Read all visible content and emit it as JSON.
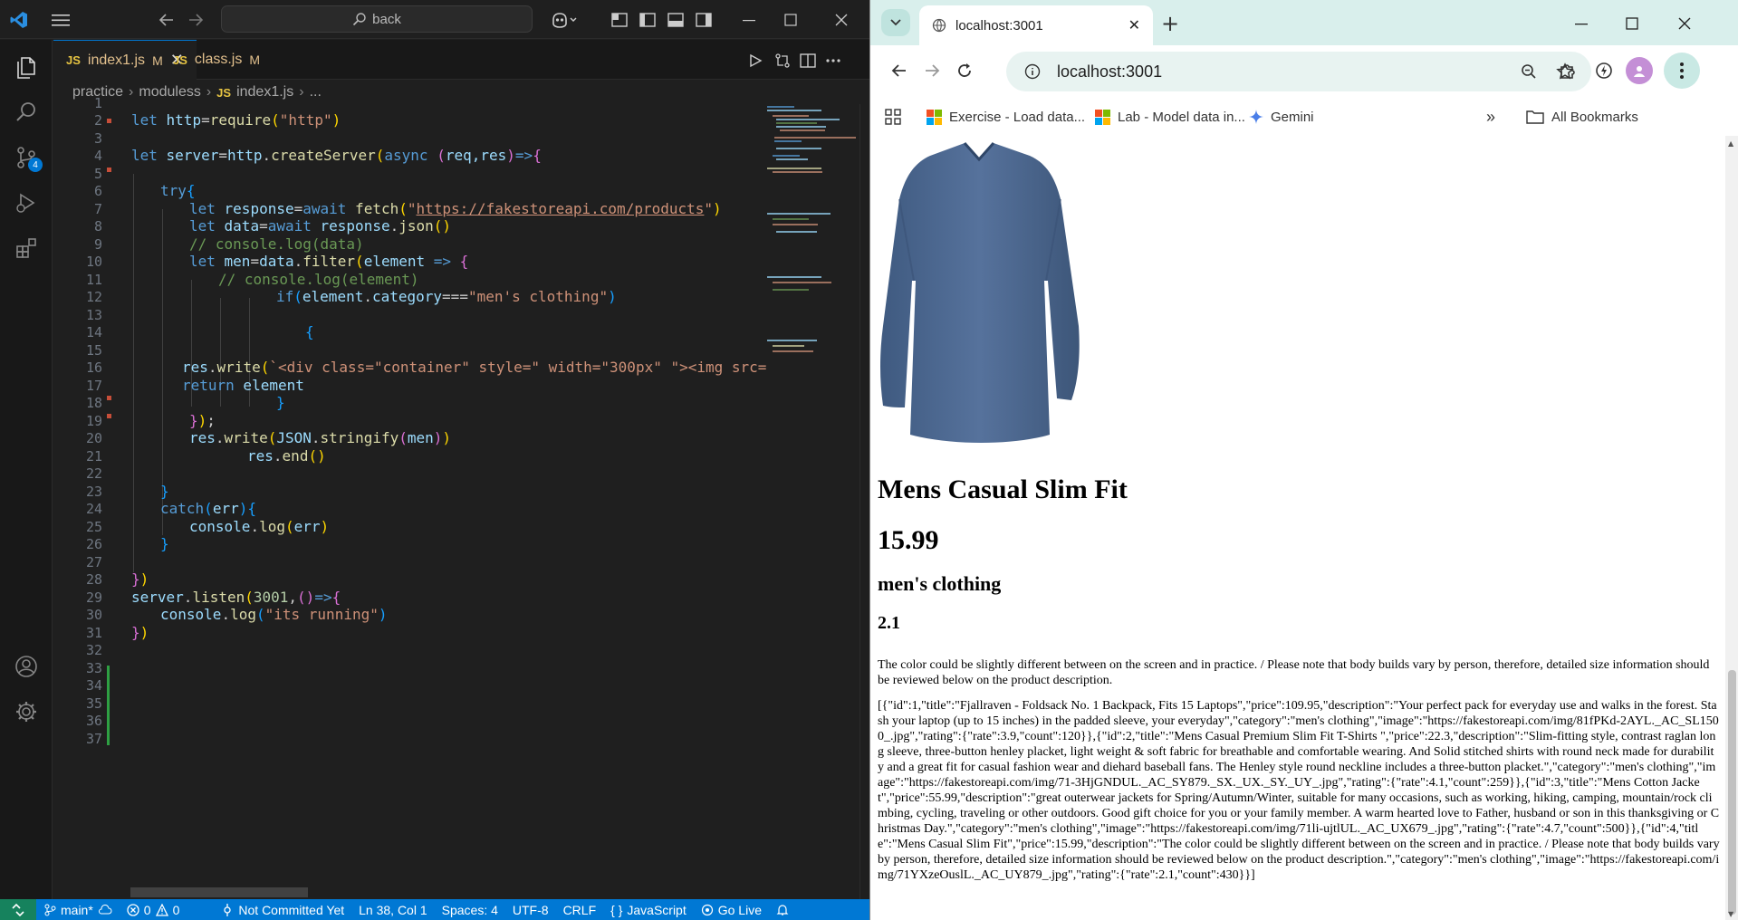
{
  "vscode": {
    "search_text": "back",
    "tabs": [
      {
        "label": "index1.js",
        "modified": "M",
        "icon": "JS"
      },
      {
        "label": "class.js",
        "modified": "M",
        "icon": "JS"
      }
    ],
    "breadcrumb": [
      "practice",
      "moduless",
      "index1.js",
      "..."
    ],
    "scm_badge": "4",
    "statusbar": {
      "branch": "main*",
      "errors": "0",
      "warnings": "0",
      "commit": "Not Committed Yet",
      "position": "Ln 38, Col 1",
      "spaces": "Spaces: 4",
      "encoding": "UTF-8",
      "eol": "CRLF",
      "language": "JavaScript",
      "golive": "Go Live"
    },
    "line_numbers": [
      "1",
      "2",
      "3",
      "4",
      "5",
      "6",
      "7",
      "8",
      "9",
      "10",
      "11",
      "12",
      "13",
      "14",
      "15",
      "16",
      "17",
      "18",
      "19",
      "20",
      "21",
      "22",
      "23",
      "24",
      "25",
      "26",
      "27",
      "28",
      "29",
      "30",
      "31",
      "32",
      "33",
      "34",
      "35",
      "36",
      "37"
    ],
    "code": {
      "l2_let": "let",
      "l2_http": " http",
      "l2_eq": "=",
      "l2_req": "require",
      "l2_str": "\"http\"",
      "l4_let": "let",
      "l4_server": " server",
      "l4_eq": "=",
      "l4_http": "http",
      "l4_create": "createServer",
      "l4_async": "async",
      "l4_args": "req,res",
      "l4_arrow": "=>",
      "l6_try": "try",
      "l7_let": "let",
      "l7_resp": " response",
      "l7_await": "await",
      "l7_fetch": " fetch",
      "l7_url": "https://fakestoreapi.com/products",
      "l8_let": "let",
      "l8_data": " data",
      "l8_await": "await",
      "l8_resp": " response",
      "l8_json": "json",
      "l9_comment": "// console.log(data)",
      "l10_let": "let",
      "l10_men": " men",
      "l10_data": "data",
      "l10_filter": "filter",
      "l10_el": "element",
      "l10_arrow": " => ",
      "l11_comment": "// console.log(element)",
      "l12_if": "if",
      "l12_el": "element",
      "l12_cat": "category",
      "l12_op": "===",
      "l12_str": "\"men's clothing\"",
      "l16_res": "res",
      "l16_write": "write",
      "l16_tpl": "`<div class=\"container\" style=\" width=\"300px\" \"><img src=",
      "l17_return": "return",
      "l17_el": " element",
      "l20_res": "res",
      "l20_write": "write",
      "l20_json": "JSON",
      "l20_str": "stringify",
      "l20_men": "men",
      "l21_res": "res",
      "l21_end": "end",
      "l24_catch": "catch",
      "l24_err": "err",
      "l25_console": "console",
      "l25_log": "log",
      "l25_err": "err",
      "l29_server": "server",
      "l29_listen": "listen",
      "l29_port": "3001",
      "l29_arrow": "=>",
      "l30_console": "console",
      "l30_log": "log",
      "l30_str": "\"its running\""
    }
  },
  "chrome": {
    "tab_title": "localhost:3001",
    "url": "localhost:3001",
    "bookmarks": [
      {
        "label": "Exercise - Load data..."
      },
      {
        "label": "Lab - Model data in..."
      },
      {
        "label": "Gemini"
      },
      {
        "label": "All Bookmarks"
      }
    ],
    "page": {
      "title": "Mens Casual Slim Fit",
      "price": "15.99",
      "category": "men's clothing",
      "rating": "2.1",
      "description": "The color could be slightly different between on the screen and in practice. / Please note that body builds vary by person, therefore, detailed size information should be reviewed below on the product description.",
      "json_output": "[{\"id\":1,\"title\":\"Fjallraven - Foldsack No. 1 Backpack, Fits 15 Laptops\",\"price\":109.95,\"description\":\"Your perfect pack for everyday use and walks in the forest. Stash your laptop (up to 15 inches) in the padded sleeve, your everyday\",\"category\":\"men's clothing\",\"image\":\"https://fakestoreapi.com/img/81fPKd-2AYL._AC_SL1500_.jpg\",\"rating\":{\"rate\":3.9,\"count\":120}},{\"id\":2,\"title\":\"Mens Casual Premium Slim Fit T-Shirts \",\"price\":22.3,\"description\":\"Slim-fitting style, contrast raglan long sleeve, three-button henley placket, light weight & soft fabric for breathable and comfortable wearing. And Solid stitched shirts with round neck made for durability and a great fit for casual fashion wear and diehard baseball fans. The Henley style round neckline includes a three-button placket.\",\"category\":\"men's clothing\",\"image\":\"https://fakestoreapi.com/img/71-3HjGNDUL._AC_SY879._SX._UX._SY._UY_.jpg\",\"rating\":{\"rate\":4.1,\"count\":259}},{\"id\":3,\"title\":\"Mens Cotton Jacket\",\"price\":55.99,\"description\":\"great outerwear jackets for Spring/Autumn/Winter, suitable for many occasions, such as working, hiking, camping, mountain/rock climbing, cycling, traveling or other outdoors. Good gift choice for you or your family member. A warm hearted love to Father, husband or son in this thanksgiving or Christmas Day.\",\"category\":\"men's clothing\",\"image\":\"https://fakestoreapi.com/img/71li-ujtlUL._AC_UX679_.jpg\",\"rating\":{\"rate\":4.7,\"count\":500}},{\"id\":4,\"title\":\"Mens Casual Slim Fit\",\"price\":15.99,\"description\":\"The color could be slightly different between on the screen and in practice. / Please note that body builds vary by person, therefore, detailed size information should be reviewed below on the product description.\",\"category\":\"men's clothing\",\"image\":\"https://fakestoreapi.com/img/71YXzeOuslL._AC_UY879_.jpg\",\"rating\":{\"rate\":2.1,\"count\":430}}]"
    }
  },
  "colors": {
    "vscode_bg": "#1f1f1f",
    "statusbar": "#0078d4",
    "chrome_frame": "#d9efec",
    "shirt": "#4a6690"
  }
}
